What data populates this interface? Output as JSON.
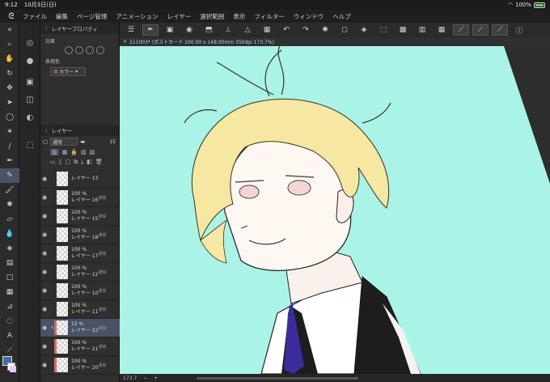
{
  "status_bar": {
    "time": "9:12",
    "date": "10月3日(日)",
    "battery": "100%"
  },
  "menu": [
    "ファイル",
    "編集",
    "ページ管理",
    "アニメーション",
    "レイヤー",
    "選択範囲",
    "表示",
    "フィルター",
    "ウィンドウ",
    "ヘルプ"
  ],
  "property_panel": {
    "title": "レイヤープロパティ",
    "effect_label": "効果",
    "color_label": "表現色",
    "color_value": "カラー"
  },
  "layer_panel": {
    "title": "レイヤー",
    "blend_mode": "通常",
    "opacity": "15",
    "layers": [
      {
        "opacity": "",
        "name": "レイヤー 13",
        "selected": false
      },
      {
        "opacity": "100 %",
        "blend": "通常",
        "name": "レイヤー 16",
        "selected": false
      },
      {
        "opacity": "100 %",
        "blend": "通常",
        "name": "レイヤー 15",
        "selected": false
      },
      {
        "opacity": "100 %",
        "blend": "通常",
        "name": "レイヤー 18",
        "selected": false
      },
      {
        "opacity": "100 %",
        "blend": "通常",
        "name": "レイヤー 17",
        "selected": false
      },
      {
        "opacity": "100 %",
        "blend": "通常",
        "name": "レイヤー 12",
        "selected": false
      },
      {
        "opacity": "100 %",
        "blend": "通常",
        "name": "レイヤー 10",
        "selected": false
      },
      {
        "opacity": "100 %",
        "blend": "通常",
        "name": "レイヤー 11",
        "selected": false
      },
      {
        "opacity": "15 %",
        "blend": "通常",
        "name": "レイヤー 22",
        "selected": true
      },
      {
        "opacity": "100 %",
        "blend": "通常",
        "name": "レイヤー 21",
        "selected": false
      },
      {
        "opacity": "100 %",
        "blend": "通常",
        "name": "レイヤー 20",
        "selected": false
      }
    ]
  },
  "document_tab": "211003* (ポストカード 100.00 x 148.00mm 350dpi 173.7%)",
  "zoom": "173.7",
  "colors": {
    "canvas_bg": "#a9f4e6",
    "hair": "#f6e8a3",
    "accent": "#4a5366"
  }
}
